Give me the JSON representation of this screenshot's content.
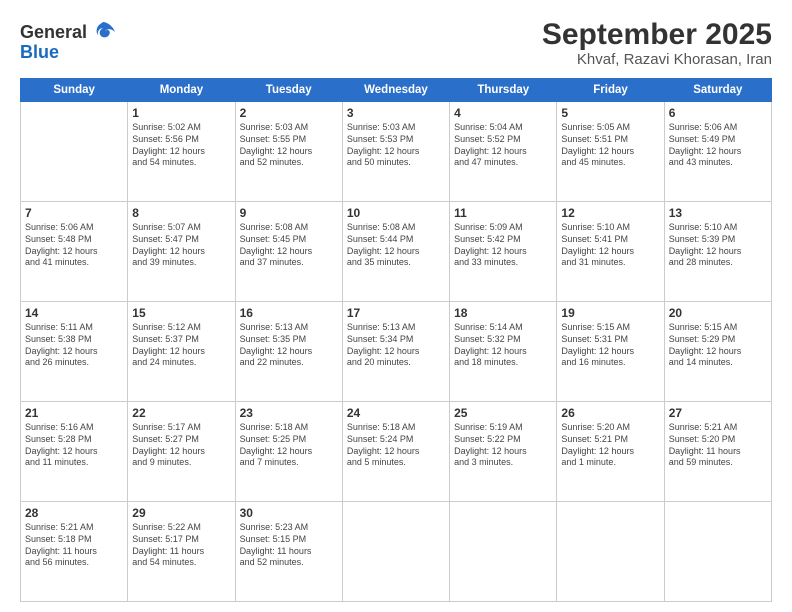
{
  "header": {
    "logo_line1": "General",
    "logo_line2": "Blue",
    "month": "September 2025",
    "location": "Khvaf, Razavi Khorasan, Iran"
  },
  "weekdays": [
    "Sunday",
    "Monday",
    "Tuesday",
    "Wednesday",
    "Thursday",
    "Friday",
    "Saturday"
  ],
  "weeks": [
    [
      {
        "day": "",
        "info": ""
      },
      {
        "day": "1",
        "info": "Sunrise: 5:02 AM\nSunset: 5:56 PM\nDaylight: 12 hours\nand 54 minutes."
      },
      {
        "day": "2",
        "info": "Sunrise: 5:03 AM\nSunset: 5:55 PM\nDaylight: 12 hours\nand 52 minutes."
      },
      {
        "day": "3",
        "info": "Sunrise: 5:03 AM\nSunset: 5:53 PM\nDaylight: 12 hours\nand 50 minutes."
      },
      {
        "day": "4",
        "info": "Sunrise: 5:04 AM\nSunset: 5:52 PM\nDaylight: 12 hours\nand 47 minutes."
      },
      {
        "day": "5",
        "info": "Sunrise: 5:05 AM\nSunset: 5:51 PM\nDaylight: 12 hours\nand 45 minutes."
      },
      {
        "day": "6",
        "info": "Sunrise: 5:06 AM\nSunset: 5:49 PM\nDaylight: 12 hours\nand 43 minutes."
      }
    ],
    [
      {
        "day": "7",
        "info": "Sunrise: 5:06 AM\nSunset: 5:48 PM\nDaylight: 12 hours\nand 41 minutes."
      },
      {
        "day": "8",
        "info": "Sunrise: 5:07 AM\nSunset: 5:47 PM\nDaylight: 12 hours\nand 39 minutes."
      },
      {
        "day": "9",
        "info": "Sunrise: 5:08 AM\nSunset: 5:45 PM\nDaylight: 12 hours\nand 37 minutes."
      },
      {
        "day": "10",
        "info": "Sunrise: 5:08 AM\nSunset: 5:44 PM\nDaylight: 12 hours\nand 35 minutes."
      },
      {
        "day": "11",
        "info": "Sunrise: 5:09 AM\nSunset: 5:42 PM\nDaylight: 12 hours\nand 33 minutes."
      },
      {
        "day": "12",
        "info": "Sunrise: 5:10 AM\nSunset: 5:41 PM\nDaylight: 12 hours\nand 31 minutes."
      },
      {
        "day": "13",
        "info": "Sunrise: 5:10 AM\nSunset: 5:39 PM\nDaylight: 12 hours\nand 28 minutes."
      }
    ],
    [
      {
        "day": "14",
        "info": "Sunrise: 5:11 AM\nSunset: 5:38 PM\nDaylight: 12 hours\nand 26 minutes."
      },
      {
        "day": "15",
        "info": "Sunrise: 5:12 AM\nSunset: 5:37 PM\nDaylight: 12 hours\nand 24 minutes."
      },
      {
        "day": "16",
        "info": "Sunrise: 5:13 AM\nSunset: 5:35 PM\nDaylight: 12 hours\nand 22 minutes."
      },
      {
        "day": "17",
        "info": "Sunrise: 5:13 AM\nSunset: 5:34 PM\nDaylight: 12 hours\nand 20 minutes."
      },
      {
        "day": "18",
        "info": "Sunrise: 5:14 AM\nSunset: 5:32 PM\nDaylight: 12 hours\nand 18 minutes."
      },
      {
        "day": "19",
        "info": "Sunrise: 5:15 AM\nSunset: 5:31 PM\nDaylight: 12 hours\nand 16 minutes."
      },
      {
        "day": "20",
        "info": "Sunrise: 5:15 AM\nSunset: 5:29 PM\nDaylight: 12 hours\nand 14 minutes."
      }
    ],
    [
      {
        "day": "21",
        "info": "Sunrise: 5:16 AM\nSunset: 5:28 PM\nDaylight: 12 hours\nand 11 minutes."
      },
      {
        "day": "22",
        "info": "Sunrise: 5:17 AM\nSunset: 5:27 PM\nDaylight: 12 hours\nand 9 minutes."
      },
      {
        "day": "23",
        "info": "Sunrise: 5:18 AM\nSunset: 5:25 PM\nDaylight: 12 hours\nand 7 minutes."
      },
      {
        "day": "24",
        "info": "Sunrise: 5:18 AM\nSunset: 5:24 PM\nDaylight: 12 hours\nand 5 minutes."
      },
      {
        "day": "25",
        "info": "Sunrise: 5:19 AM\nSunset: 5:22 PM\nDaylight: 12 hours\nand 3 minutes."
      },
      {
        "day": "26",
        "info": "Sunrise: 5:20 AM\nSunset: 5:21 PM\nDaylight: 12 hours\nand 1 minute."
      },
      {
        "day": "27",
        "info": "Sunrise: 5:21 AM\nSunset: 5:20 PM\nDaylight: 11 hours\nand 59 minutes."
      }
    ],
    [
      {
        "day": "28",
        "info": "Sunrise: 5:21 AM\nSunset: 5:18 PM\nDaylight: 11 hours\nand 56 minutes."
      },
      {
        "day": "29",
        "info": "Sunrise: 5:22 AM\nSunset: 5:17 PM\nDaylight: 11 hours\nand 54 minutes."
      },
      {
        "day": "30",
        "info": "Sunrise: 5:23 AM\nSunset: 5:15 PM\nDaylight: 11 hours\nand 52 minutes."
      },
      {
        "day": "",
        "info": ""
      },
      {
        "day": "",
        "info": ""
      },
      {
        "day": "",
        "info": ""
      },
      {
        "day": "",
        "info": ""
      }
    ]
  ]
}
